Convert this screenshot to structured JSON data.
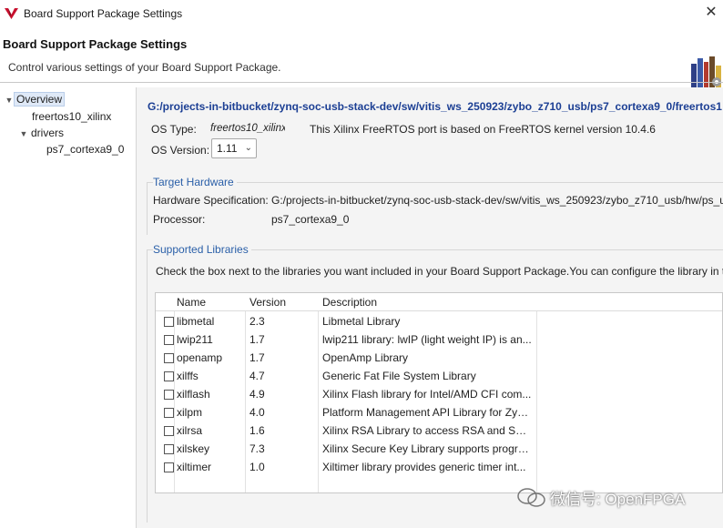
{
  "window": {
    "title": "Board Support Package Settings",
    "close_glyph": "✕",
    "app_icon": "vitis-logo-icon"
  },
  "header": {
    "title": "Board Support Package Settings",
    "subtitle": "Control various settings of your Board Support Package.",
    "icon": "books-icon"
  },
  "tree": {
    "items": [
      {
        "label": "Overview",
        "toggle": "▼",
        "selected": true
      },
      {
        "label": "freertos10_xilinx",
        "toggle": ""
      },
      {
        "label": "drivers",
        "toggle": "▼"
      },
      {
        "label": "ps7_cortexa9_0",
        "toggle": ""
      }
    ]
  },
  "overview": {
    "path": "G:/projects-in-bitbucket/zynq-soc-usb-stack-dev/sw/vitis_ws_250923/zybo_z710_usb/ps7_cortexa9_0/freertos1",
    "os_type_label": "OS Type:",
    "os_type_value": "freertos10_xilinx",
    "os_type_desc": "This Xilinx FreeRTOS port is based on FreeRTOS kernel version 10.4.6",
    "os_version_label": "OS Version:",
    "os_version_value": "1.11"
  },
  "target_hardware": {
    "title": "Target Hardware",
    "hw_spec_label": "Hardware Specification:",
    "hw_spec_value": "G:/projects-in-bitbucket/zynq-soc-usb-stack-dev/sw/vitis_ws_250923/zybo_z710_usb/hw/ps_u",
    "processor_label": "Processor:",
    "processor_value": "ps7_cortexa9_0"
  },
  "supported_libraries": {
    "title": "Supported Libraries",
    "note": "Check the box next to the libraries you want included in your Board Support Package.You can configure the library in t",
    "columns": [
      "Name",
      "Version",
      "Description"
    ],
    "rows": [
      {
        "name": "libmetal",
        "version": "2.3",
        "description": "Libmetal Library",
        "checked": false
      },
      {
        "name": "lwip211",
        "version": "1.7",
        "description": "lwip211 library: lwIP (light weight IP) is an...",
        "checked": false
      },
      {
        "name": "openamp",
        "version": "1.7",
        "description": "OpenAmp Library",
        "checked": false
      },
      {
        "name": "xilffs",
        "version": "4.7",
        "description": "Generic Fat File System Library",
        "checked": false
      },
      {
        "name": "xilflash",
        "version": "4.9",
        "description": "Xilinx Flash library for Intel/AMD CFI com...",
        "checked": false
      },
      {
        "name": "xilpm",
        "version": "4.0",
        "description": "Platform Management API Library for Zyn...",
        "checked": false
      },
      {
        "name": "xilrsa",
        "version": "1.6",
        "description": "Xilinx RSA Library to access RSA and SHA ...",
        "checked": false
      },
      {
        "name": "xilskey",
        "version": "7.3",
        "description": "Xilinx Secure Key Library supports progra...",
        "checked": false
      },
      {
        "name": "xiltimer",
        "version": "1.0",
        "description": "Xiltimer library provides generic timer int...",
        "checked": false
      }
    ]
  },
  "watermark": {
    "text": "微信号: OpenFPGA",
    "icon": "wechat-icon"
  }
}
